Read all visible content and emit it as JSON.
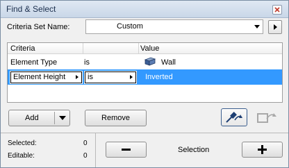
{
  "window": {
    "title": "Find & Select"
  },
  "criteria_set": {
    "label": "Criteria Set Name:",
    "value": "Custom"
  },
  "list": {
    "columns": [
      "Criteria",
      "Value"
    ],
    "rows": [
      {
        "criteria": "Element Type",
        "operator": "is",
        "value": "Wall",
        "icon": "wall-icon"
      },
      {
        "criteria": "Element Height",
        "operator": "is",
        "value": "Inverted",
        "selected": true
      }
    ]
  },
  "buttons": {
    "add": "Add",
    "remove": "Remove"
  },
  "status": {
    "selected_label": "Selected:",
    "selected_count": "0",
    "editable_label": "Editable:",
    "editable_count": "0"
  },
  "selection": {
    "label": "Selection"
  },
  "colors": {
    "highlight": "#3399ff",
    "titlebar": "#d4dfee"
  }
}
